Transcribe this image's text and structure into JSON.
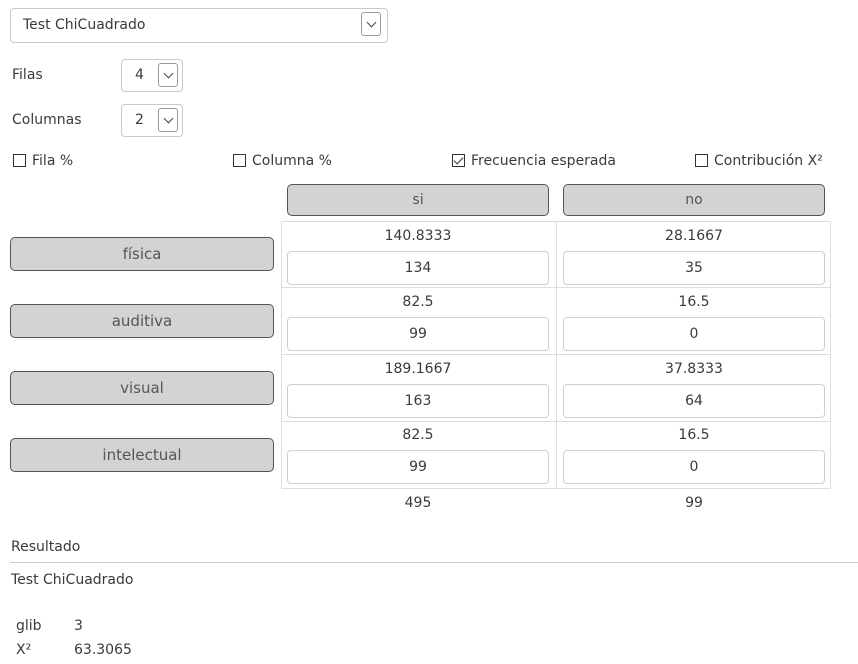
{
  "test_select": {
    "value": "Test ChiCuadrado"
  },
  "filas": {
    "label": "Filas",
    "value": "4"
  },
  "columnas": {
    "label": "Columnas",
    "value": "2"
  },
  "options": {
    "fila_pct": {
      "label": "Fila %",
      "checked": false
    },
    "columna_pct": {
      "label": "Columna %",
      "checked": false
    },
    "frecuencia_esperada": {
      "label": "Frecuencia esperada",
      "checked": true
    },
    "contribucion": {
      "label": "Contribución X²",
      "checked": false
    }
  },
  "columns": [
    "si",
    "no"
  ],
  "rows": [
    {
      "label": "física",
      "expected": [
        "140.8333",
        "28.1667"
      ],
      "observed": [
        "134",
        "35"
      ]
    },
    {
      "label": "auditiva",
      "expected": [
        "82.5",
        "16.5"
      ],
      "observed": [
        "99",
        "0"
      ]
    },
    {
      "label": "visual",
      "expected": [
        "189.1667",
        "37.8333"
      ],
      "observed": [
        "163",
        "64"
      ]
    },
    {
      "label": "intelectual",
      "expected": [
        "82.5",
        "16.5"
      ],
      "observed": [
        "99",
        "0"
      ]
    }
  ],
  "totals": [
    "495",
    "99"
  ],
  "result": {
    "heading": "Resultado",
    "test_name": "Test ChiCuadrado",
    "glib_label": "glib",
    "glib_value": "3",
    "x2_label": "X²",
    "x2_value": "63.3065"
  }
}
